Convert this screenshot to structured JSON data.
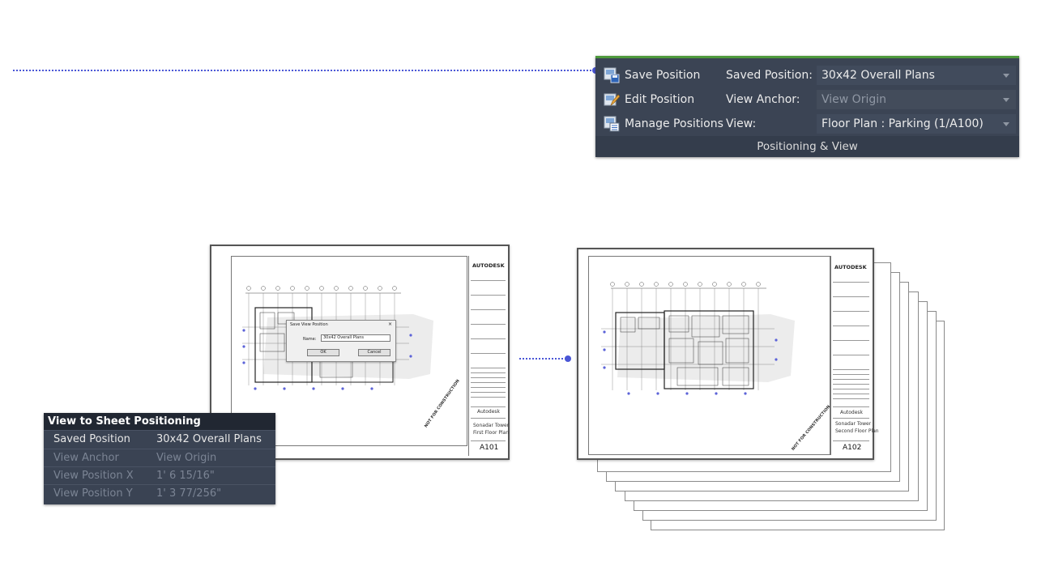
{
  "ribbon": {
    "buttons": [
      {
        "label": "Save Position",
        "icon": "save-position-icon"
      },
      {
        "label": "Edit Position",
        "icon": "edit-position-icon"
      },
      {
        "label": "Manage Positions",
        "icon": "manage-positions-icon"
      }
    ],
    "fields": [
      {
        "label": "Saved Position:",
        "value": "30x42 Overall Plans",
        "enabled": true
      },
      {
        "label": "View Anchor:",
        "value": "View Origin",
        "enabled": false
      },
      {
        "label": "View:",
        "value": "Floor Plan : Parking (1/A100)",
        "enabled": true
      }
    ],
    "panel_title": "Positioning & View",
    "colors": {
      "background": "#3b4454",
      "accent": "#4e9a3c"
    }
  },
  "left_sheet": {
    "logo": "AUTODESK",
    "project": "Autodesk",
    "title_line1": "Sonadar Tower",
    "title_line2": "First Floor Plan",
    "sheet_number": "A101",
    "stamp": "NOT FOR CONSTRUCTION",
    "dialog": {
      "title": "Save View Position",
      "close": "×",
      "name_label": "Name:",
      "name_value": "30x42 Overall Plans",
      "ok_label": "OK",
      "cancel_label": "Cancel"
    }
  },
  "right_sheet": {
    "logo": "AUTODESK",
    "project": "Autodesk",
    "title_line1": "Sonadar Tower",
    "title_line2": "Second Floor Plan",
    "sheet_number": "A102",
    "stamp": "NOT FOR CONSTRUCTION"
  },
  "properties": {
    "title": "View to Sheet Positioning",
    "rows": [
      {
        "key": "Saved Position",
        "value": "30x42 Overall Plans",
        "enabled": true
      },
      {
        "key": "View Anchor",
        "value": "View Origin",
        "enabled": false
      },
      {
        "key": "View Position X",
        "value": "1'  6 15/16\"",
        "enabled": false
      },
      {
        "key": "View Position Y",
        "value": "1'  3 77/256\"",
        "enabled": false
      }
    ]
  },
  "colors": {
    "connector": "#4a56d6"
  }
}
